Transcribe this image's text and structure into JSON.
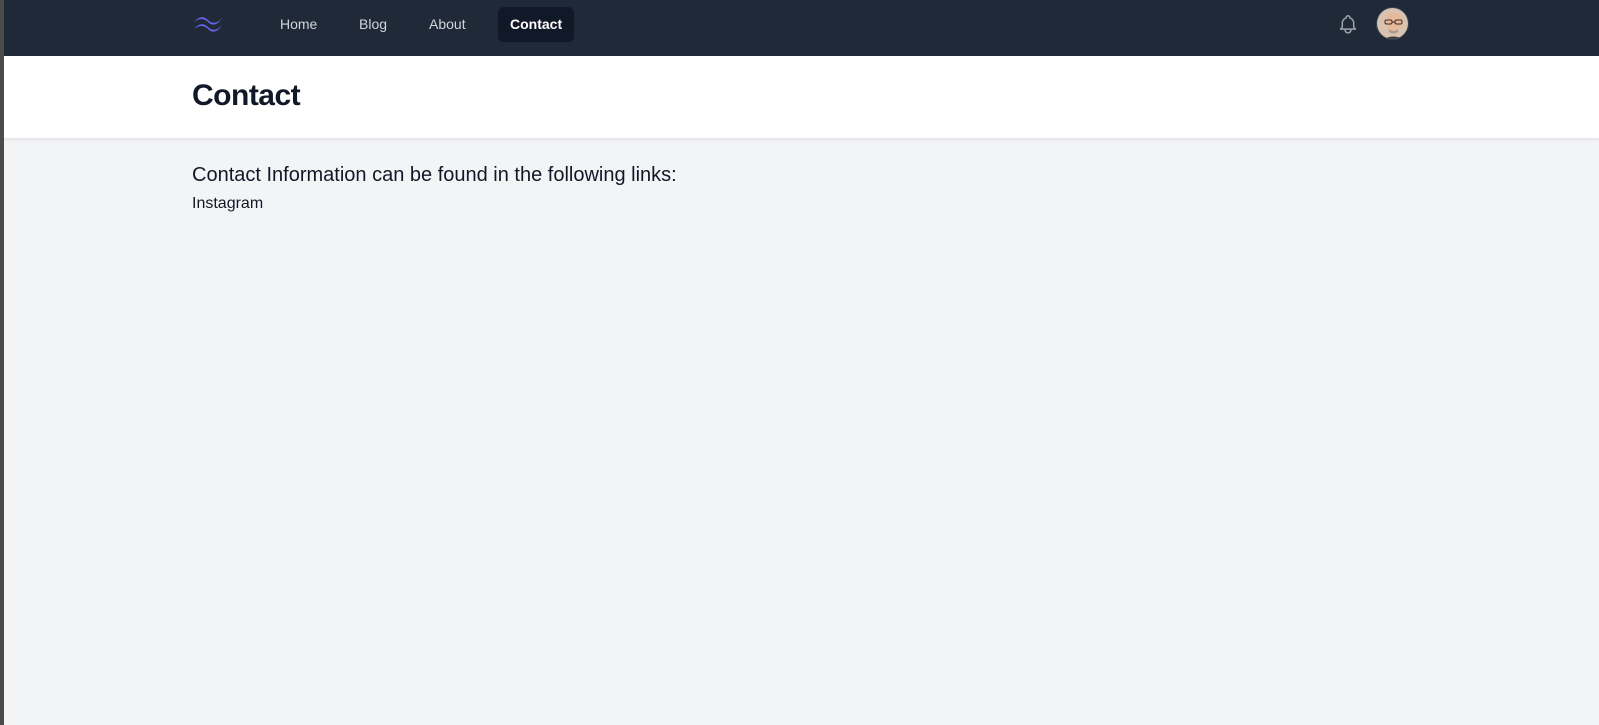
{
  "nav": {
    "logo_icon": "tailwind-wave-logo",
    "items": [
      {
        "label": "Home",
        "active": false
      },
      {
        "label": "Blog",
        "active": false
      },
      {
        "label": "About",
        "active": false
      },
      {
        "label": "Contact",
        "active": true
      }
    ],
    "notification_icon": "bell-icon",
    "avatar_icon": "user-avatar"
  },
  "header": {
    "title": "Contact"
  },
  "main": {
    "intro": "Contact Information can be found in the following links:",
    "links": [
      {
        "label": "Instagram"
      }
    ]
  },
  "colors": {
    "nav_bg": "#1f2937",
    "active_bg": "#111827",
    "page_bg": "#f3f4f6",
    "logo": "#6366f1"
  }
}
